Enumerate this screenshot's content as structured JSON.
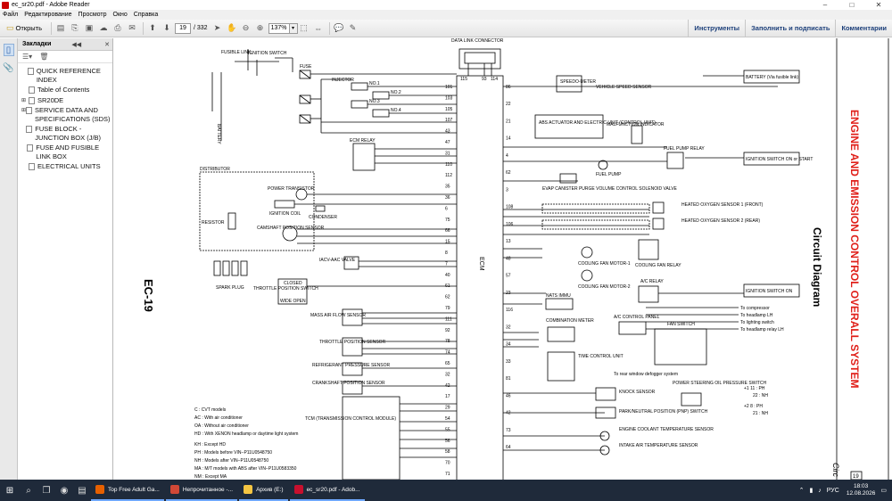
{
  "window": {
    "title": "ec_sr20.pdf - Adobe Reader",
    "controls": [
      "–",
      "□",
      "✕"
    ]
  },
  "menu": [
    "Файл",
    "Редактирование",
    "Просмотр",
    "Окно",
    "Справка"
  ],
  "toolbar": {
    "open_label": "Открыть",
    "page_current": "19",
    "page_total": "/ 332",
    "zoom": "137%",
    "right_tabs": [
      "Инструменты",
      "Заполнить и подписать",
      "Комментарии"
    ]
  },
  "bookmarks": {
    "title": "Закладки",
    "items": [
      {
        "label": "QUICK REFERENCE INDEX",
        "expandable": false
      },
      {
        "label": "Table of Contents",
        "expandable": false
      },
      {
        "label": "SR20DE",
        "expandable": true
      },
      {
        "label": "SERVICE DATA AND SPECIFICATIONS (SDS)",
        "expandable": true
      },
      {
        "label": "FUSE BLOCK - JUNCTION BOX (J/B)",
        "expandable": false
      },
      {
        "label": "FUSE AND FUSIBLE LINK BOX",
        "expandable": false
      },
      {
        "label": "ELECTRICAL UNITS",
        "expandable": false
      }
    ]
  },
  "diagram": {
    "page_code": "EC-19",
    "side_title": "ENGINE AND EMISSION CONTROL OVERALL SYSTEM",
    "section_title": "Circuit Diagram",
    "ecm_label": "ECM",
    "labels": {
      "fusible_link": "FUSIBLE LINK",
      "ignition_switch": "IGNITION SWITCH",
      "fuse": "FUSE",
      "data_link": "DATA LINK CONNECTOR",
      "injector": "INJECTOR",
      "no1": "NO.1",
      "no2": "NO.2",
      "no3": "NO.3",
      "no4": "NO.4",
      "battery": "BATTERY",
      "ecm_relay": "ECM RELAY",
      "distributor": "DISTRIBUTOR",
      "power_transistor": "POWER TRANSISTOR",
      "ignition_coil": "IGNITION COIL",
      "condenser": "CONDENSER",
      "resistor": "RESISTOR",
      "camshaft": "CAMSHAFT POSITION SENSOR",
      "spark_plug": "SPARK PLUG",
      "iacv": "IACV-AAC VALVE",
      "throttle_sw": "THROTTLE POSITION SWITCH",
      "closed": "CLOSED",
      "wide_open": "WIDE OPEN",
      "maf": "MASS AIR FLOW SENSOR",
      "tps": "THROTTLE POSITION SENSOR",
      "refrig": "REFRIGERANT PRESSURE SENSOR",
      "crank": "CRANKSHAFT POSITION SENSOR",
      "tcm": "TCM (TRANSMISSION CONTROL MODULE)",
      "speedometer": "SPEEDO-METER",
      "vss": "VEHICLE SPEED SENSOR",
      "abs": "ABS ACTUATOR AND ELECTRIC UNIT (CONTROL UNIT)",
      "malfunction": "MALFUNCTION INDICATOR",
      "fuel_pump_relay": "FUEL PUMP RELAY",
      "fuel_pump": "FUEL PUMP",
      "evap": "EVAP CANISTER PURGE VOLUME CONTROL SOLENOID VALVE",
      "ho2s1": "HEATED OXYGEN SENSOR 1 (FRONT)",
      "ho2s2": "HEATED OXYGEN SENSOR 2 (REAR)",
      "cooling_fan_relay": "COOLING FAN RELAY",
      "fan1": "COOLING FAN MOTOR-1",
      "fan2": "COOLING FAN MOTOR-2",
      "nats": "NATS IMMU",
      "ac_relay": "A/C RELAY",
      "combination_meter": "COMBINATION METER",
      "ac_panel": "A/C CONTROL PANEL",
      "fan_switch": "FAN SWITCH",
      "time_control": "TIME CONTROL UNIT",
      "rear_defog": "To rear window defogger system",
      "knock": "KNOCK SENSOR",
      "ps_switch": "POWER STEERING OIL PRESSURE SWITCH",
      "pnp": "PARK/NEUTRAL POSITION (PNP) SWITCH",
      "ect": "ENGINE COOLANT TEMPERATURE SENSOR",
      "iat": "INTAKE AIR TEMPERATURE SENSOR",
      "battery_right": "BATTERY (Via fusible link)",
      "ign_on_start": "IGNITION SWITCH ON or START",
      "ign_on": "IGNITION SWITCH ON",
      "to_compressor": "To compressor",
      "to_headlamp": "To headlamp LH",
      "to_lighting": "To lighting switch",
      "to_headlamp_relay": "To headlamp relay LH"
    },
    "legend": [
      "C : CVT models",
      "AC : With air conditioner",
      "OA : Without air conditioner",
      "HD : With XENON headlamp or daytime light system",
      "KH : Except HD",
      "PH : Models before VIN−P11U0548750",
      "NH : Models after VIN−P11U0548750",
      "MA : M/T models with ABS after VIN−P11U0583350",
      "NM : Except MA"
    ],
    "ecm_pins_left": [
      "101",
      "103",
      "105",
      "107",
      "43",
      "47",
      "31",
      "110",
      "112",
      "35",
      "36",
      "6",
      "75",
      "66",
      "15",
      "8",
      "7",
      "40",
      "61",
      "62",
      "79",
      "111",
      "92",
      "78",
      "74",
      "65",
      "32",
      "42",
      "17",
      "29",
      "54",
      "55",
      "56",
      "58",
      "70",
      "71"
    ],
    "ecm_pins_right": [
      "86",
      "22",
      "21",
      "14",
      "4",
      "62",
      "3",
      "108",
      "106",
      "13",
      "48",
      "57",
      "23",
      "116",
      "32",
      "34",
      "33",
      "81",
      "46",
      "42",
      "73",
      "64"
    ],
    "dlc_pins": [
      "115",
      "93",
      "114"
    ],
    "side_notes": [
      "+1  11 : PH",
      "22 : NH",
      "+2  8 : PH",
      "21 : NH"
    ],
    "page_footer": "Circ",
    "page_number": "19"
  },
  "taskbar": {
    "apps": [
      {
        "label": "Top Free Adult Ga...",
        "color": "#e66000"
      },
      {
        "label": "Непрочитанное -...",
        "color": "#d14836"
      },
      {
        "label": "Архив (E:)",
        "color": "#f5c542"
      },
      {
        "label": "ec_sr20.pdf - Adob...",
        "color": "#c8102e"
      }
    ],
    "lang": "РУС",
    "time": "18:03",
    "date": "12.08.2026"
  }
}
